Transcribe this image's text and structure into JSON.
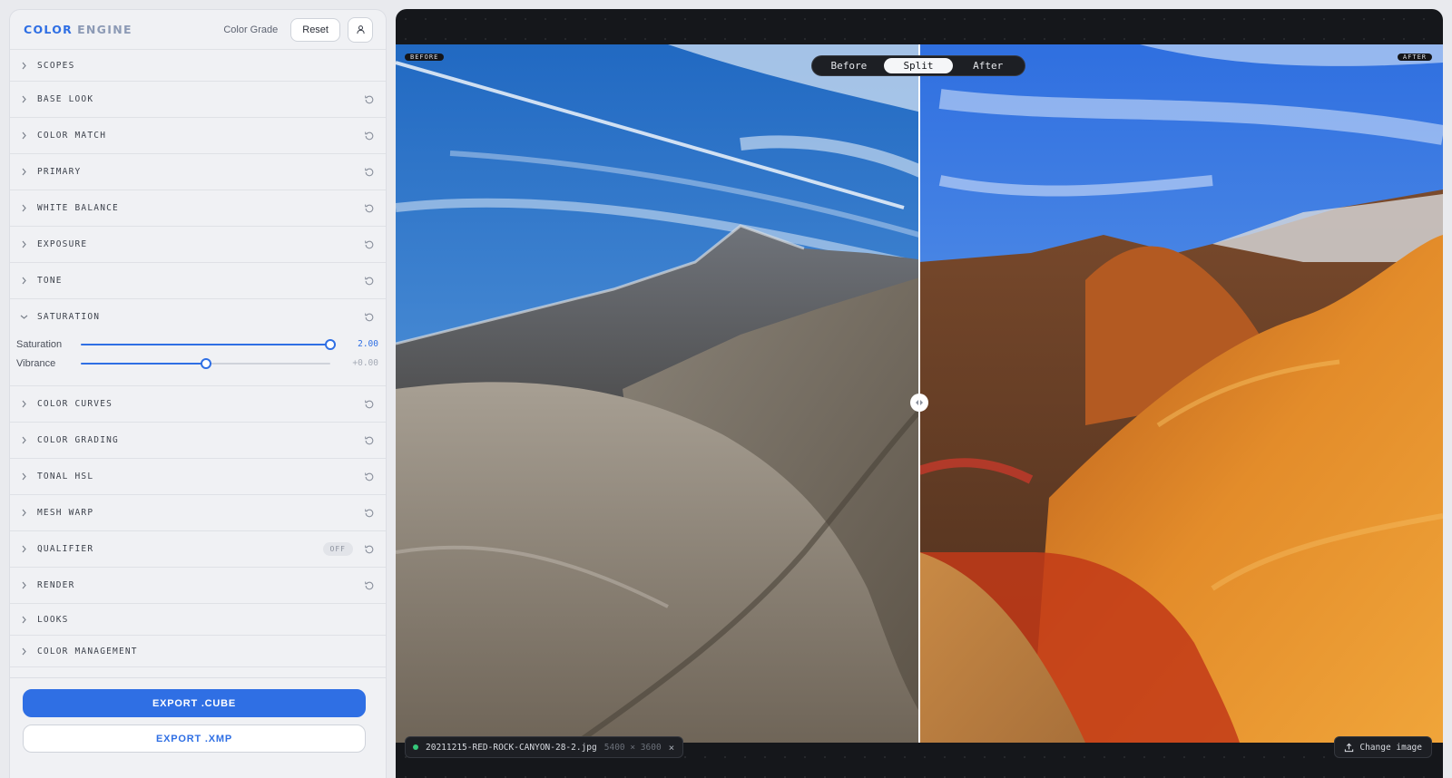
{
  "sidebar": {
    "logo": {
      "part1": "COLOR",
      "part2": "ENGINE"
    },
    "mode_label": "Color Grade",
    "reset_label": "Reset",
    "user_icon": "user-icon",
    "sections": [
      {
        "key": "scopes",
        "title": "SCOPES"
      },
      {
        "key": "base-look",
        "title": "BASE LOOK"
      },
      {
        "key": "color-match",
        "title": "COLOR MATCH"
      },
      {
        "key": "primary",
        "title": "PRIMARY"
      },
      {
        "key": "white-balance",
        "title": "WHITE BALANCE"
      },
      {
        "key": "exposure",
        "title": "EXPOSURE"
      },
      {
        "key": "tone",
        "title": "TONE"
      },
      {
        "key": "saturation",
        "title": "SATURATION",
        "expanded": true,
        "controls": [
          {
            "label": "Saturation",
            "value": 2.0,
            "display": "2.00",
            "min": 0,
            "max": 2
          },
          {
            "label": "Vibrance",
            "value": 0,
            "display": "+0.00",
            "min": -1,
            "max": 1
          }
        ]
      },
      {
        "key": "color-curves",
        "title": "COLOR CURVES"
      },
      {
        "key": "color-grading",
        "title": "COLOR GRADING"
      },
      {
        "key": "tonal-hsl",
        "title": "TONAL HSL"
      },
      {
        "key": "mesh-warp",
        "title": "MESH WARP"
      },
      {
        "key": "qualifier",
        "title": "QUALIFIER",
        "badge": "OFF"
      },
      {
        "key": "render",
        "title": "RENDER"
      },
      {
        "key": "looks",
        "title": "LOOKS"
      },
      {
        "key": "color-management",
        "title": "COLOR MANAGEMENT"
      }
    ],
    "export_cube_label": "EXPORT .CUBE",
    "export_xmp_label": "EXPORT .XMP"
  },
  "viewer": {
    "before_tag": "BEFORE",
    "after_tag": "AFTER",
    "compare_modes": [
      "Before",
      "Split",
      "After"
    ],
    "selected_mode": "Split",
    "split_position": 0.5,
    "file": {
      "name": "20211215-RED-ROCK-CANYON-28-2.jpg",
      "dimensions": "5400 × 3600",
      "close_glyph": "×"
    },
    "change_image_label": "Change image"
  },
  "colors": {
    "accent": "#2f6fe4",
    "status_dot": "#35c77a"
  }
}
